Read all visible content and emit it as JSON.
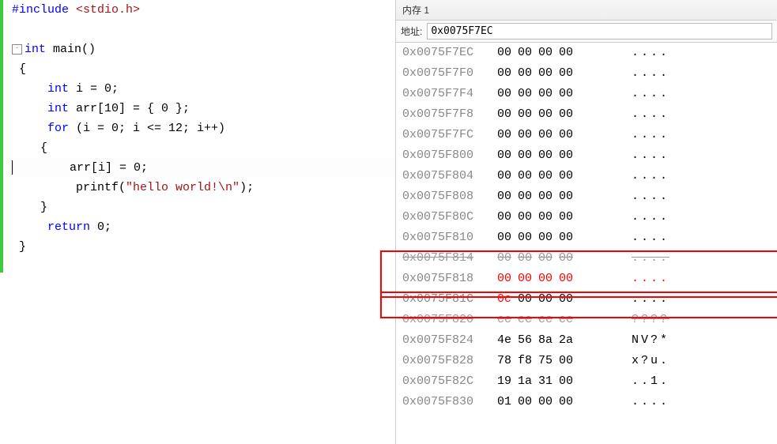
{
  "code": {
    "include_kw": "#include",
    "include_lib": "<stdio.h>",
    "int_kw": "int",
    "main_name": " main()",
    "brace_open": "{",
    "decl_i": "    int i = 0;",
    "decl_arr_prefix": "    int",
    "decl_arr_rest": " arr[10] = { 0 };",
    "for_kw": "    for",
    "for_cond": " (i = 0; i <= 12; i++)",
    "for_brace_open": "    {",
    "arr_assign": "        arr[i] = 0;",
    "printf_name": "        printf(",
    "printf_str": "\"hello world!\\n\"",
    "printf_end": ");",
    "for_brace_close": "    }",
    "return_kw": "    return",
    "return_val": " 0;",
    "brace_close": "}"
  },
  "memory": {
    "panel_title": "内存 1",
    "addr_label": "地址:",
    "addr_value": "0x0075F7EC",
    "rows": [
      {
        "addr": "0x0075F7EC",
        "b": [
          "00",
          "00",
          "00",
          "00"
        ],
        "ascii": "....",
        "red": false,
        "strike": false
      },
      {
        "addr": "0x0075F7F0",
        "b": [
          "00",
          "00",
          "00",
          "00"
        ],
        "ascii": "....",
        "red": false,
        "strike": false
      },
      {
        "addr": "0x0075F7F4",
        "b": [
          "00",
          "00",
          "00",
          "00"
        ],
        "ascii": "....",
        "red": false,
        "strike": false
      },
      {
        "addr": "0x0075F7F8",
        "b": [
          "00",
          "00",
          "00",
          "00"
        ],
        "ascii": "....",
        "red": false,
        "strike": false
      },
      {
        "addr": "0x0075F7FC",
        "b": [
          "00",
          "00",
          "00",
          "00"
        ],
        "ascii": "....",
        "red": false,
        "strike": false
      },
      {
        "addr": "0x0075F800",
        "b": [
          "00",
          "00",
          "00",
          "00"
        ],
        "ascii": "....",
        "red": false,
        "strike": false
      },
      {
        "addr": "0x0075F804",
        "b": [
          "00",
          "00",
          "00",
          "00"
        ],
        "ascii": "....",
        "red": false,
        "strike": false
      },
      {
        "addr": "0x0075F808",
        "b": [
          "00",
          "00",
          "00",
          "00"
        ],
        "ascii": "....",
        "red": false,
        "strike": false
      },
      {
        "addr": "0x0075F80C",
        "b": [
          "00",
          "00",
          "00",
          "00"
        ],
        "ascii": "....",
        "red": false,
        "strike": false
      },
      {
        "addr": "0x0075F810",
        "b": [
          "00",
          "00",
          "00",
          "00"
        ],
        "ascii": "....",
        "red": false,
        "strike": false
      },
      {
        "addr": "0x0075F814",
        "b": [
          "00",
          "00",
          "00",
          "00"
        ],
        "ascii": "....",
        "red": false,
        "strike": true
      },
      {
        "addr": "0x0075F818",
        "b": [
          "00",
          "00",
          "00",
          "00"
        ],
        "ascii": "....",
        "red": true,
        "strike": false
      },
      {
        "addr": "0x0075F81C",
        "b": [
          "0c",
          "00",
          "00",
          "00"
        ],
        "ascii": "....",
        "red": true,
        "redFirst": true,
        "strike": false
      },
      {
        "addr": "0x0075F820",
        "b": [
          "cc",
          "cc",
          "cc",
          "cc"
        ],
        "ascii": "????",
        "red": false,
        "strike": true
      },
      {
        "addr": "0x0075F824",
        "b": [
          "4e",
          "56",
          "8a",
          "2a"
        ],
        "ascii": "NV?*",
        "red": false,
        "strike": false
      },
      {
        "addr": "0x0075F828",
        "b": [
          "78",
          "f8",
          "75",
          "00"
        ],
        "ascii": "x?u.",
        "red": false,
        "strike": false
      },
      {
        "addr": "0x0075F82C",
        "b": [
          "19",
          "1a",
          "31",
          "00"
        ],
        "ascii": "..1.",
        "red": false,
        "strike": false
      },
      {
        "addr": "0x0075F830",
        "b": [
          "01",
          "00",
          "00",
          "00"
        ],
        "ascii": "....",
        "red": false,
        "strike": false
      }
    ]
  }
}
